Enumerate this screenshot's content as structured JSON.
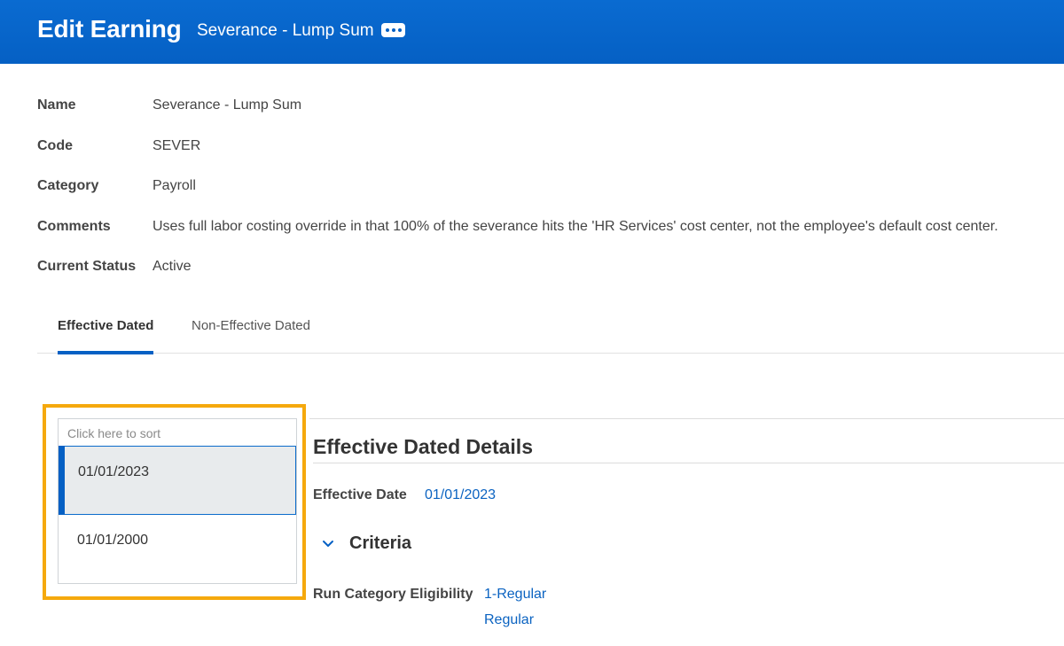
{
  "header": {
    "title": "Edit Earning",
    "subtitle": "Severance - Lump Sum",
    "more_icon": "ellipsis-icon"
  },
  "fields": {
    "name": {
      "label": "Name",
      "value": "Severance - Lump Sum"
    },
    "code": {
      "label": "Code",
      "value": "SEVER"
    },
    "category": {
      "label": "Category",
      "value": "Payroll"
    },
    "comments": {
      "label": "Comments",
      "value": "Uses full labor costing override in that 100% of the severance hits the 'HR Services' cost center, not the employee's default cost center."
    },
    "status": {
      "label": "Current Status",
      "value": "Active"
    }
  },
  "tabs": [
    {
      "label": "Effective Dated",
      "active": true
    },
    {
      "label": "Non-Effective Dated",
      "active": false
    }
  ],
  "date_list": {
    "sort_hint": "Click here to sort",
    "items": [
      {
        "date": "01/01/2023",
        "selected": true
      },
      {
        "date": "01/01/2000",
        "selected": false
      }
    ]
  },
  "details": {
    "title": "Effective Dated Details",
    "effective_date_label": "Effective Date",
    "effective_date_value": "01/01/2023",
    "criteria_title": "Criteria",
    "criteria_icon": "chevron-down-icon",
    "run_category_label": "Run Category Eligibility",
    "run_category_values": [
      "1-Regular",
      "Regular"
    ]
  },
  "colors": {
    "header_bg": "#0560c4",
    "accent": "#0560c4",
    "link": "#0b63c1",
    "highlight": "#f5a90d",
    "selected_bg": "#e8ebed"
  }
}
